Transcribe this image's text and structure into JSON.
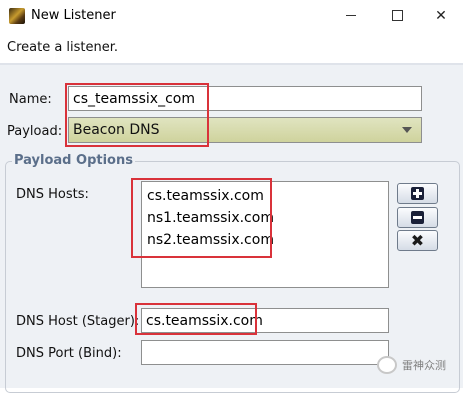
{
  "window": {
    "title": "New Listener",
    "controls": {
      "minimize": "minimize",
      "maximize": "maximize",
      "close": "close"
    }
  },
  "description": "Create a listener.",
  "form": {
    "name_label": "Name:",
    "name_value": "cs_teamssix_com",
    "payload_label": "Payload:",
    "payload_value": "Beacon DNS"
  },
  "payload_options": {
    "title": "Payload Options",
    "dns_hosts_label": "DNS Hosts:",
    "dns_hosts": [
      "cs.teamssix.com",
      "ns1.teamssix.com",
      "ns2.teamssix.com"
    ],
    "buttons": [
      "add",
      "remove",
      "clear"
    ],
    "dns_host_stager_label": "DNS Host (Stager):",
    "dns_host_stager_value": "cs.teamssix.com",
    "dns_port_bind_label": "DNS Port (Bind):",
    "dns_port_bind_value": ""
  },
  "watermark": {
    "text": "雷神众测"
  },
  "colors": {
    "highlight": "#d9323a",
    "group_title": "#5b6f8a",
    "select_bg": "#d8dcaf"
  }
}
